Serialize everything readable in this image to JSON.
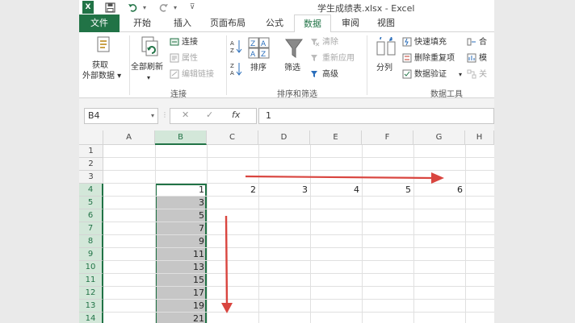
{
  "title": {
    "text": "学生成绩表.xlsx - Excel"
  },
  "quick_access": {
    "save_icon": "save-icon",
    "undo_icon": "undo-icon",
    "redo_icon": "redo-icon",
    "customize_icon": "customize-icon"
  },
  "tabs": [
    "文件",
    "开始",
    "插入",
    "页面布局",
    "公式",
    "数据",
    "审阅",
    "视图"
  ],
  "active_tab": "数据",
  "ribbon": {
    "get_external_data_line1": "获取",
    "get_external_data_line2": "外部数据 ▾",
    "refresh_all": "全部刷新",
    "refresh_all_caret": "▾",
    "connections": "连接",
    "properties": "属性",
    "edit_links": "编辑链接",
    "group_connections": "连接",
    "sort": "排序",
    "filter": "筛选",
    "clear": "清除",
    "reapply": "重新应用",
    "advanced": "高级",
    "group_sort_filter": "排序和筛选",
    "text_to_columns": "分列",
    "flash_fill": "快速填充",
    "remove_duplicates": "删除重复项",
    "data_validation": "数据验证",
    "data_validation_caret": "▾",
    "consolidate_partial": "合",
    "whatif_partial": "模",
    "relationships_partial": "关",
    "group_data_tools": "数据工具"
  },
  "formula_bar": {
    "name_box": "B4",
    "name_box_caret": "▾",
    "cancel_symbol": "✕",
    "enter_symbol": "✓",
    "fx_symbol": "fx",
    "formula_value": "1"
  },
  "columns": [
    "A",
    "B",
    "C",
    "D",
    "E",
    "F",
    "G",
    "H"
  ],
  "rows": [
    "1",
    "2",
    "3",
    "4",
    "5",
    "6",
    "7",
    "8",
    "9",
    "10",
    "11",
    "12",
    "13",
    "14"
  ],
  "cells": {
    "row4": [
      "1",
      "2",
      "3",
      "4",
      "5",
      "6"
    ],
    "colB": [
      "3",
      "5",
      "7",
      "9",
      "11",
      "13",
      "15",
      "17",
      "19",
      "21"
    ]
  },
  "colors": {
    "accent": "#217346",
    "arrow": "#d9453f",
    "selection": "#c6c6c6"
  }
}
